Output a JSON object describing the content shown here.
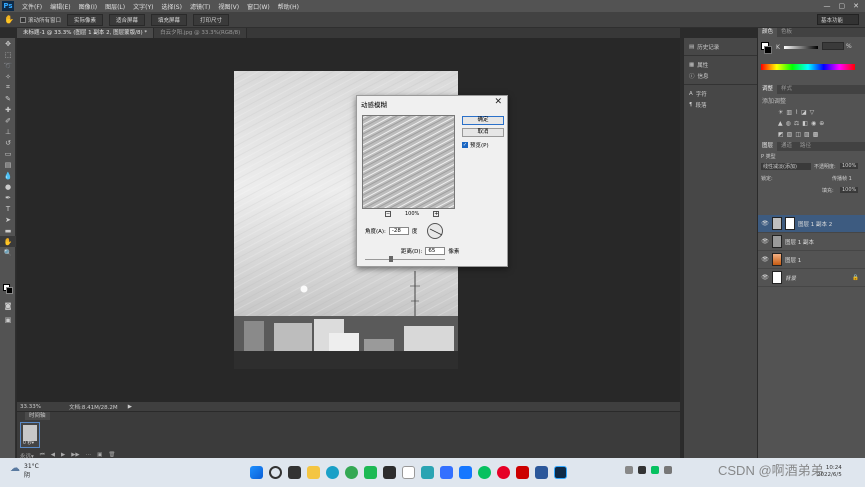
{
  "app": {
    "logo": "Ps"
  },
  "menu": [
    "文件(F)",
    "编辑(E)",
    "图像(I)",
    "图层(L)",
    "文字(Y)",
    "选择(S)",
    "滤镜(T)",
    "视图(V)",
    "窗口(W)",
    "帮助(H)"
  ],
  "window_controls": [
    "—",
    "▢",
    "✕"
  ],
  "options_bar": {
    "scroll_all": "滚动所有窗口",
    "actual_pixels": "实际像素",
    "fit_screen": "适合屏幕",
    "fill_screen": "填充屏幕",
    "print_size": "打印尺寸",
    "workspace": "基本功能"
  },
  "tabs": [
    "未标题-1 @ 33.3% (图层 1 副本 2, 图层蒙版/8) *",
    "白云夕阳.jpg @ 33.3%(RGB/8)"
  ],
  "status": {
    "zoom": "33.33%",
    "doc": "文档:8.41M/28.2M",
    "arrow": "▶"
  },
  "timeline": {
    "tab": "时间轴",
    "frame_duration": "0 秒▾",
    "loop": "永远▾"
  },
  "collapsed_panels": [
    {
      "icon": "history-icon",
      "label": "历史记录"
    },
    {
      "icon": "properties-icon",
      "label": "属性"
    },
    {
      "icon": "info-icon",
      "label": "信息"
    },
    {
      "icon": "character-icon",
      "label": "字符"
    },
    {
      "icon": "paragraph-icon",
      "label": "段落"
    }
  ],
  "color_panel": {
    "tabs": [
      "颜色",
      "色板"
    ],
    "slider_label": "K",
    "value": "%"
  },
  "adjust_panel": {
    "tabs": [
      "调整",
      "样式"
    ],
    "hint": "添加调整"
  },
  "layers_panel": {
    "tabs": [
      "图层",
      "通道",
      "路径"
    ],
    "kind": "P 类型",
    "blend_mode": "线性减淡(添加)",
    "opacity_label": "不透明度:",
    "opacity": "100%",
    "lock_label": "锁定:",
    "fill_label": "填充:",
    "fill": "100%",
    "unify_label": "传播帧 1",
    "layers": [
      {
        "name": "图层 1 副本 2",
        "selected": true
      },
      {
        "name": "图层 1 副本",
        "selected": false
      },
      {
        "name": "图层 1",
        "selected": false
      },
      {
        "name": "背景",
        "selected": false
      }
    ]
  },
  "dialog": {
    "title": "动感模糊",
    "ok": "确定",
    "cancel": "取消",
    "preview_label": "预览(P)",
    "zoom": "100%",
    "angle_label": "角度(A):",
    "angle": "-28",
    "angle_unit": "度",
    "distance_label": "距离(D):",
    "distance": "65",
    "distance_unit": "像素",
    "distance_level": 0.33
  },
  "taskbar": {
    "temp": "31°C",
    "weather": "阴",
    "time": "10:24",
    "date": "2022/6/5",
    "watermark": "CSDN @啊酒弟弟"
  }
}
